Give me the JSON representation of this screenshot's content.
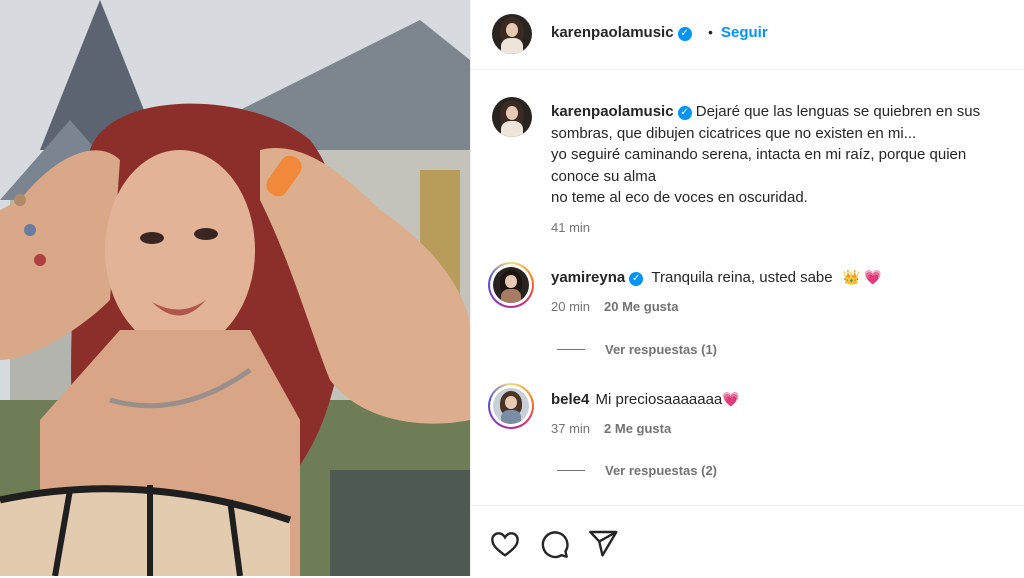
{
  "header": {
    "username": "karenpaolamusic",
    "verified_icon": "verified-badge-icon",
    "separator": "•",
    "follow_label": "Seguir"
  },
  "caption": {
    "username": "karenpaolamusic",
    "lines": [
      "Dejaré que las lenguas se quiebren en sus",
      "sombras, que dibujen cicatrices que no existen en mi...",
      "yo seguiré caminando serena, intacta en mi raíz, porque quien",
      "conoce su alma",
      "no teme al eco de voces en oscuridad."
    ],
    "time": "41 min"
  },
  "comments": [
    {
      "username": "yamireyna",
      "verified": true,
      "text": "Tranquila reina, usted sabe",
      "emojis": "👑 💗",
      "time": "20 min",
      "likes": "20 Me gusta",
      "replies": "Ver respuestas (1)"
    },
    {
      "username": "bele4",
      "verified": false,
      "text": "Mi preciosaaaaaaa",
      "emojis": "💗",
      "time": "37 min",
      "likes": "2 Me gusta",
      "replies": "Ver respuestas (2)"
    }
  ],
  "actions": [
    "heart-icon",
    "comment-icon",
    "share-icon"
  ],
  "colors": {
    "link": "#0095f6",
    "muted": "#737373",
    "text": "#262626"
  }
}
